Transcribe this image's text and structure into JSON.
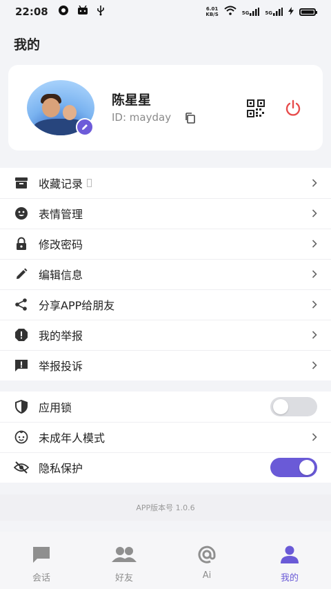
{
  "status_bar": {
    "time": "22:08",
    "net_speed_value": "6.01",
    "net_speed_unit": "KB/S",
    "signal1_label": "5G",
    "signal2_label": "5G",
    "icons": [
      "notification-icon",
      "android-icon",
      "usb-icon",
      "wifi-icon",
      "signal-icon",
      "signal-icon",
      "charging-icon",
      "battery-icon"
    ]
  },
  "page": {
    "title": "我的"
  },
  "profile": {
    "name": "陈星星",
    "id_text": "ID: mayday",
    "icons": [
      "edit-icon",
      "copy-icon",
      "qr-code-icon",
      "power-icon"
    ],
    "colors": {
      "power": "#e74c4c",
      "edit_badge": "#6d5bd9"
    }
  },
  "menu_group1": [
    {
      "label": "收藏记录",
      "icon": "archive-icon"
    },
    {
      "label": "表情管理",
      "icon": "smiley-icon"
    },
    {
      "label": "修改密码",
      "icon": "lock-icon"
    },
    {
      "label": "编辑信息",
      "icon": "pencil-icon"
    },
    {
      "label": "分享APP给朋友",
      "icon": "share-icon"
    },
    {
      "label": "我的举报",
      "icon": "alert-octagon-icon"
    },
    {
      "label": "举报投诉",
      "icon": "feedback-icon"
    }
  ],
  "menu_group2": [
    {
      "label": "应用锁",
      "icon": "shield-icon",
      "control": "toggle",
      "on": false
    },
    {
      "label": "未成年人模式",
      "icon": "child-face-icon",
      "control": "chevron"
    },
    {
      "label": "隐私保护",
      "icon": "eye-off-icon",
      "control": "toggle",
      "on": true
    }
  ],
  "version": "APP版本号 1.0.6",
  "tabs": [
    {
      "label": "会话",
      "icon": "chat-icon",
      "active": false
    },
    {
      "label": "好友",
      "icon": "friends-icon",
      "active": false
    },
    {
      "label": "Ai",
      "icon": "at-icon",
      "active": false
    },
    {
      "label": "我的",
      "icon": "person-icon",
      "active": true
    }
  ],
  "colors": {
    "accent": "#6a5ad7",
    "background": "#f3f4f7",
    "card": "#ffffff"
  }
}
